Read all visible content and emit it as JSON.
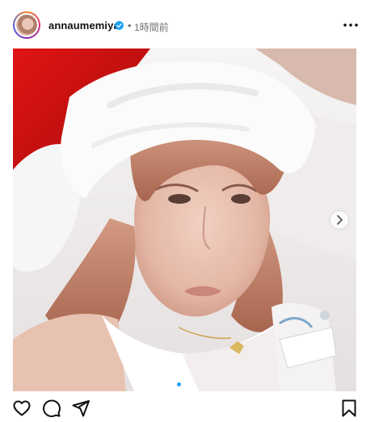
{
  "post": {
    "username": "annaumemiya",
    "timestamp": "1時間前",
    "separator": "•",
    "verified": true
  },
  "carousel": {
    "total_slides": 2,
    "active_slide": 1
  },
  "icons": {
    "more": "more-horizontal-icon",
    "like": "heart-icon",
    "comment": "comment-icon",
    "share": "send-icon",
    "save": "bookmark-icon",
    "next": "chevron-right-icon",
    "verified": "verified-badge-icon"
  },
  "colors": {
    "verified": "#1da1f2",
    "muted_text": "#737373",
    "active_dot": "#1da1f2"
  }
}
